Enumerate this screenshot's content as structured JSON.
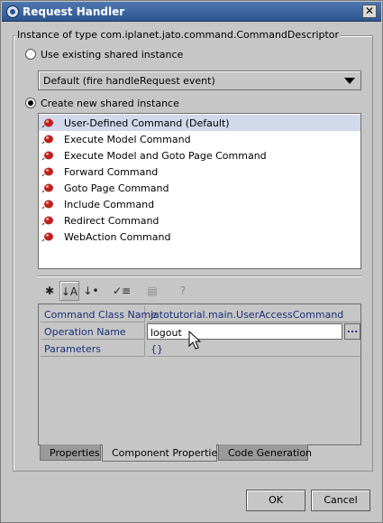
{
  "window": {
    "title": "Request Handler",
    "close_label": "✕"
  },
  "group": {
    "title": "Instance of type com.iplanet.jato.command.CommandDescriptor"
  },
  "existing": {
    "label": "Use existing shared instance",
    "selected": false,
    "combo_value": "Default (fire handleRequest event)"
  },
  "create_new": {
    "label": "Create new shared instance",
    "selected": true
  },
  "commands": [
    {
      "label": "User-Defined Command (Default)",
      "selected": true
    },
    {
      "label": "Execute Model Command",
      "selected": false
    },
    {
      "label": "Execute Model and Goto Page Command",
      "selected": false
    },
    {
      "label": "Forward Command",
      "selected": false
    },
    {
      "label": "Goto Page Command",
      "selected": false
    },
    {
      "label": "Include Command",
      "selected": false
    },
    {
      "label": "Redirect Command",
      "selected": false
    },
    {
      "label": "WebAction Command",
      "selected": false
    }
  ],
  "toolbar": {
    "buttons": [
      {
        "icon": "sort-unsorted-icon",
        "glyph": "✱"
      },
      {
        "icon": "sort-by-name-icon",
        "glyph": "↓A"
      },
      {
        "icon": "sort-by-type-icon",
        "glyph": "↓•"
      },
      {
        "icon": "show-editable-icon",
        "glyph": "✓≡"
      },
      {
        "icon": "customizer-icon",
        "glyph": "▤"
      },
      {
        "icon": "help-icon",
        "glyph": "?"
      }
    ]
  },
  "properties": [
    {
      "name": "Command Class Name",
      "value": "jatotutorial.main.UserAccessCommand"
    },
    {
      "name": "Operation Name",
      "value": "logout"
    },
    {
      "name": "Parameters",
      "value": "{}"
    }
  ],
  "ellipsis_label": "...",
  "tabs": [
    {
      "label": "Properties",
      "active": false
    },
    {
      "label": "Component Properties",
      "active": true
    },
    {
      "label": "Code Generation",
      "active": false
    }
  ],
  "buttons": {
    "ok": "OK",
    "cancel": "Cancel"
  },
  "colors": {
    "titlebar": "#2d5690",
    "selection": "#d1d9ea",
    "property_text": "#1b2f7a",
    "bean_icon": "#c0201d"
  }
}
